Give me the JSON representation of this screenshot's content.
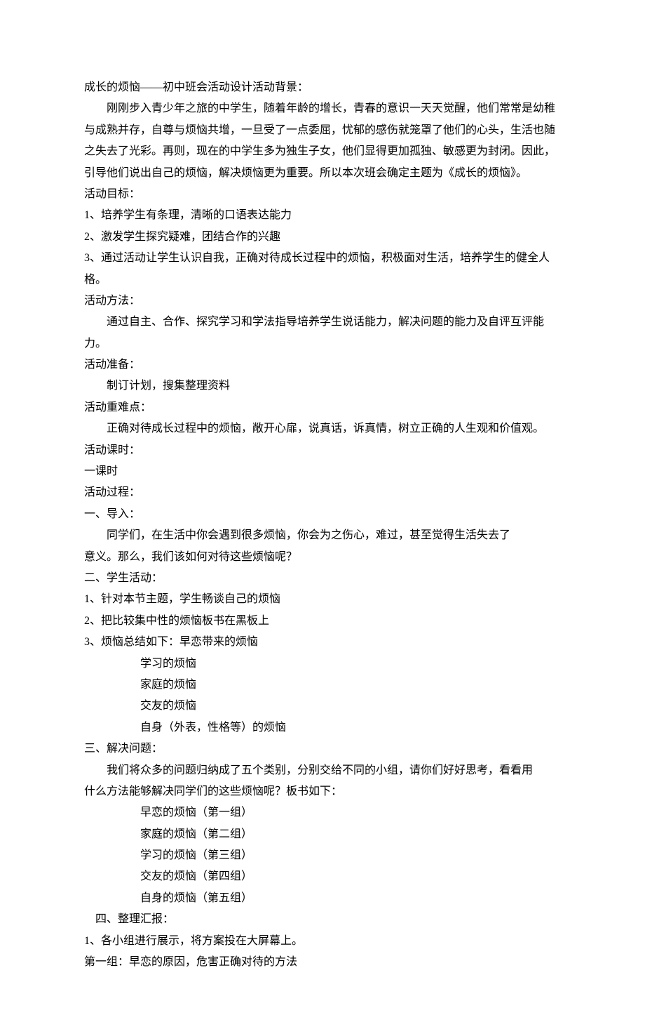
{
  "title": "成长的烦恼――初中班会活动设计活动背景：",
  "background": "刚刚步入青少年之旅的中学生，随着年龄的增长，青春的意识一天天觉醒，他们常常是幼稚与成熟并存，自尊与烦恼共增，一旦受了一点委屈，忧郁的感伤就笼罩了他们的心头，生活也随之失去了光彩。再则，现在的中学生多为独生子女，他们显得更加孤独、敏感更为封闭。因此，引导他们说出自己的烦恼，解决烦恼更为重要。所以本次班会确定主题为《成长的烦恼》。",
  "goals_label": "活动目标：",
  "goals": [
    "1、培养学生有条理，清晰的口语表达能力",
    "2、激发学生探究疑难，团结合作的兴趣",
    "3、通过活动让学生认识自我，正确对待成长过程中的烦恼，积极面对生活，培养学生的健全人格。"
  ],
  "method_label": "活动方法：",
  "method": "通过自主、合作、探究学习和学法指导培养学生说话能力，解决问题的能力及自评互评能力。",
  "prep_label": "活动准备：",
  "prep": "制订计划，搜集整理资料",
  "diff_label": "活动重难点：",
  "diff": "正确对待成长过程中的烦恼，敞开心扉，说真话，诉真情，树立正确的人生观和价值观。",
  "period_label": "活动课时：",
  "period": "一课时",
  "process_label": "活动过程：",
  "s1_label": "一、导入：",
  "s1_content_line1": "同学们，在生活中你会遇到很多烦恼，你会为之伤心，难过，甚至觉得生活失去了",
  "s1_content_line2": "意义。那么，我们该如何对待这些烦恼呢？",
  "s2_label": "二、学生活动：",
  "s2_items": [
    "1、针对本节主题，学生畅谈自己的烦恼",
    "2、把比较集中性的烦恼板书在黑板上",
    "3、烦恼总结如下：早恋带来的烦恼"
  ],
  "s2_sublist": [
    "学习的烦恼",
    "家庭的烦恼",
    "交友的烦恼",
    "自身（外表，性格等）的烦恼"
  ],
  "s3_label": "三、解决问题：",
  "s3_content_line1": "我们将众多的问题归纳成了五个类别，分别交给不同的小组，请你们好好思考，看看用",
  "s3_content_line2": "什么方法能够解决同学们的这些烦恼呢？板书如下：",
  "s3_groups": [
    "早恋的烦恼（第一组）",
    "家庭的烦恼（第二组）",
    "学习的烦恼（第三组）",
    "交友的烦恼（第四组）",
    "自身的烦恼（第五组）"
  ],
  "s4_label": "四、整理汇报：",
  "s4_item1": "1、各小组进行展示，将方案投在大屏幕上。",
  "s4_group1": "第一组：早恋的原因，危害正确对待的方法"
}
